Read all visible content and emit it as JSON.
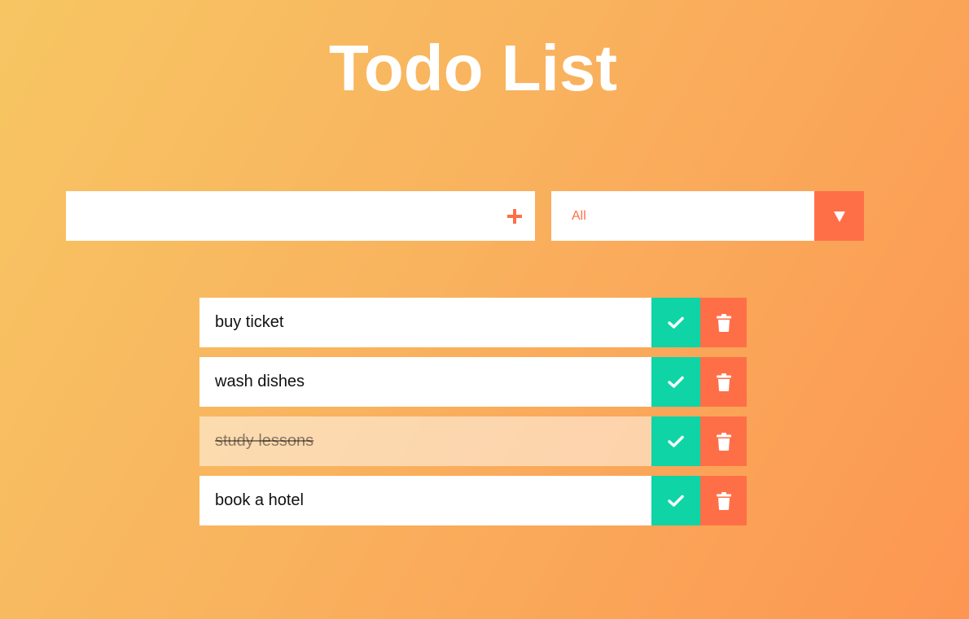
{
  "header": {
    "title": "Todo List"
  },
  "form": {
    "input_value": "",
    "input_placeholder": "",
    "add_icon": "plus-icon",
    "filter_selected": "All",
    "filter_icon": "triangle-down-icon"
  },
  "todos": [
    {
      "text": "buy ticket",
      "completed": false
    },
    {
      "text": "wash dishes",
      "completed": false
    },
    {
      "text": "study lessons",
      "completed": true
    },
    {
      "text": "book a hotel",
      "completed": false
    }
  ],
  "colors": {
    "accent": "#ff6f47",
    "check": "#0fd4a6",
    "gradient_start": "#f7c663",
    "gradient_end": "#fc9652"
  }
}
